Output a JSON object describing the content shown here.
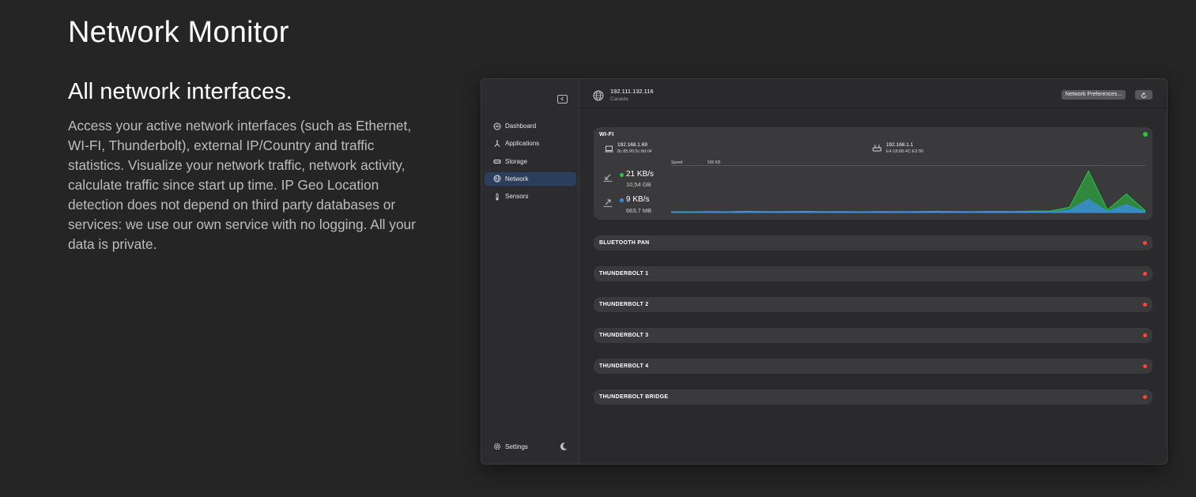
{
  "page": {
    "title": "Network Monitor",
    "section_title": "All network interfaces.",
    "description": "Access your active network interfaces (such as Ethernet, WI-FI, Thunderbolt), external IP/Country and traffic statistics. Visualize your network traffic, network activity, calculate traffic since start up time. IP Geo Location detection does not depend on third party databases or services: we use our own service with no logging. All your data is private."
  },
  "app": {
    "sidebar": {
      "toggle_icon": "sidebar-toggle-icon",
      "items": [
        {
          "label": "Dashboard",
          "icon": "dashboard-icon",
          "active": false
        },
        {
          "label": "Applications",
          "icon": "applications-icon",
          "active": false
        },
        {
          "label": "Storage",
          "icon": "storage-icon",
          "active": false
        },
        {
          "label": "Network",
          "icon": "network-icon",
          "active": true
        },
        {
          "label": "Sensors",
          "icon": "thermometer-icon",
          "active": false
        }
      ],
      "settings_label": "Settings",
      "settings_icon": "gear-icon",
      "theme_icon": "moon-icon"
    },
    "header": {
      "ip": "192.111.132.116",
      "country": "Canada",
      "preferences_button": "Network Preferences...",
      "refresh_icon": "refresh-icon"
    },
    "wifi": {
      "title": "WI-FI",
      "status": "connected",
      "local_ip": "192.168.1.69",
      "local_mac": "8c:85:90:5c:8d:04",
      "router_ip": "192.168.1.1",
      "router_mac": "E4:18:6B:4C:E3:90",
      "speed_label": "Speed",
      "speed_scale": "500 KB",
      "download_rate": "21 KB/s",
      "download_total": "10,54 GB",
      "upload_rate": "9 KB/s",
      "upload_total": "663,7 MB"
    },
    "interfaces": [
      {
        "label": "BLUETOOTH PAN",
        "status": "disconnected"
      },
      {
        "label": "THUNDERBOLT 1",
        "status": "disconnected"
      },
      {
        "label": "THUNDERBOLT 2",
        "status": "disconnected"
      },
      {
        "label": "THUNDERBOLT 3",
        "status": "disconnected"
      },
      {
        "label": "THUNDERBOLT 4",
        "status": "disconnected"
      },
      {
        "label": "THUNDERBOLT BRIDGE",
        "status": "disconnected"
      }
    ]
  },
  "colors": {
    "accent_active": "#2b3f5c",
    "download": "#28c840",
    "upload": "#3a8ee6",
    "status_on": "#28c840",
    "status_off": "#ff453a"
  },
  "chart_data": {
    "type": "area",
    "x": [
      0,
      4,
      8,
      12,
      16,
      20,
      24,
      28,
      32,
      36,
      40,
      44,
      48,
      52,
      56,
      60,
      64,
      68,
      72,
      76,
      80,
      84,
      88,
      92,
      96,
      100
    ],
    "series": [
      {
        "values": [
          10,
          8,
          12,
          9,
          14,
          10,
          11,
          13,
          10,
          12,
          9,
          11,
          10,
          12,
          14,
          11,
          10,
          13,
          12,
          15,
          18,
          60,
          470,
          30,
          210,
          20
        ]
      },
      {
        "values": [
          4,
          3,
          5,
          4,
          6,
          4,
          5,
          5,
          4,
          5,
          4,
          5,
          4,
          5,
          6,
          5,
          4,
          6,
          5,
          7,
          8,
          25,
          150,
          12,
          90,
          8
        ]
      }
    ],
    "ylim": [
      0,
      500
    ],
    "grid": false
  }
}
